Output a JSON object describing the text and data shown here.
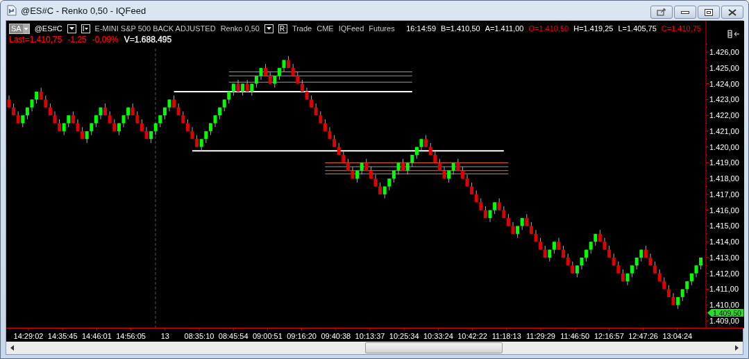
{
  "window": {
    "title": "@ES#C - Renko 0,50 - IQFeed"
  },
  "toolbar": {
    "session": "SA",
    "symbol": "@ES#C",
    "indicator_button": "I",
    "description": "E-MINI S&P 500 BACK ADJUSTED",
    "interval": "Renko 0,50",
    "range_button": "R",
    "fields": [
      "Trade",
      "CME",
      "IQFeed",
      "Futures"
    ],
    "quotes": [
      {
        "text": "16:14:59",
        "color": "#ffffff"
      },
      {
        "text": "B=1.410,50",
        "color": "#ffffff"
      },
      {
        "text": "A=1.411,00",
        "color": "#ffffff"
      },
      {
        "text": "O=1.410,50",
        "color": "#ff0000"
      },
      {
        "text": "H=1.419,25",
        "color": "#ffffff"
      },
      {
        "text": "L=1.405,75",
        "color": "#ffffff"
      },
      {
        "text": "C=1.410,75",
        "color": "#ff0000"
      }
    ],
    "last": [
      {
        "text": "Last=1.410,75",
        "color": "#ff0000"
      },
      {
        "text": "-1,25",
        "color": "#ff0000"
      },
      {
        "text": "-0,09%",
        "color": "#ff0000"
      },
      {
        "text": "V=1.688.495",
        "color": "#ffffff"
      }
    ]
  },
  "chart_data": {
    "type": "candlestick",
    "ylim": [
      1408.56,
      1427.98
    ],
    "ohlc": [
      [
        1423,
        1423.25,
        1422.5,
        1422.5
      ],
      [
        1422.5,
        1422.75,
        1422,
        1422
      ],
      [
        1422,
        1422.25,
        1421.5,
        1421.5
      ],
      [
        1421.5,
        1422,
        1421.25,
        1422
      ],
      [
        1422,
        1422.5,
        1421.75,
        1422.5
      ],
      [
        1422.5,
        1423,
        1422.25,
        1423
      ],
      [
        1423,
        1423.5,
        1422.75,
        1423.5
      ],
      [
        1423.5,
        1423.75,
        1423,
        1423
      ],
      [
        1423,
        1423.25,
        1422.5,
        1422.5
      ],
      [
        1422.5,
        1422.75,
        1422,
        1422
      ],
      [
        1422,
        1422.25,
        1421.5,
        1421.5
      ],
      [
        1421.5,
        1421.75,
        1421,
        1421
      ],
      [
        1421,
        1421.5,
        1420.75,
        1421.5
      ],
      [
        1421.5,
        1422,
        1421.25,
        1422
      ],
      [
        1422,
        1422.25,
        1421.5,
        1421.5
      ],
      [
        1421.5,
        1421.75,
        1421,
        1421
      ],
      [
        1421,
        1421.25,
        1420.5,
        1420.5
      ],
      [
        1420.5,
        1421,
        1420.25,
        1421
      ],
      [
        1421,
        1421.5,
        1420.75,
        1421.5
      ],
      [
        1421.5,
        1422,
        1421.25,
        1422
      ],
      [
        1422,
        1422.5,
        1421.75,
        1422.5
      ],
      [
        1422.5,
        1422.75,
        1422,
        1422
      ],
      [
        1422,
        1422.25,
        1421.5,
        1421.5
      ],
      [
        1421.5,
        1421.75,
        1421,
        1421
      ],
      [
        1421,
        1421.5,
        1420.75,
        1421.5
      ],
      [
        1421.5,
        1422,
        1421.25,
        1422
      ],
      [
        1422,
        1422.5,
        1421.75,
        1422.5
      ],
      [
        1422.5,
        1422.75,
        1422,
        1422
      ],
      [
        1422,
        1422.25,
        1421.5,
        1421.5
      ],
      [
        1421.5,
        1421.75,
        1421,
        1421
      ],
      [
        1421,
        1421.25,
        1420.5,
        1420.5
      ],
      [
        1420.5,
        1421,
        1420.25,
        1421
      ],
      [
        1421,
        1421.5,
        1420.75,
        1421.5
      ],
      [
        1421.5,
        1422,
        1421.25,
        1422
      ],
      [
        1422,
        1422.5,
        1421.75,
        1422.5
      ],
      [
        1422.5,
        1423,
        1422.25,
        1423
      ],
      [
        1423,
        1423.25,
        1422.5,
        1422.5
      ],
      [
        1422.5,
        1422.75,
        1422,
        1422
      ],
      [
        1422,
        1422.25,
        1421.5,
        1421.5
      ],
      [
        1421.5,
        1421.75,
        1421,
        1421
      ],
      [
        1421,
        1421.25,
        1420.5,
        1420.5
      ],
      [
        1420.5,
        1420.75,
        1420,
        1420
      ],
      [
        1420,
        1420.5,
        1419.75,
        1420.5
      ],
      [
        1420.5,
        1421,
        1420.25,
        1421
      ],
      [
        1421,
        1421.5,
        1420.75,
        1421.5
      ],
      [
        1421.5,
        1422,
        1421.25,
        1422
      ],
      [
        1422,
        1422.5,
        1421.75,
        1422.5
      ],
      [
        1422.5,
        1423,
        1422.25,
        1423
      ],
      [
        1423,
        1423.5,
        1422.75,
        1423.5
      ],
      [
        1423.5,
        1424,
        1423.25,
        1424
      ],
      [
        1424,
        1424.25,
        1423.5,
        1423.5
      ],
      [
        1423.5,
        1424,
        1423.25,
        1424
      ],
      [
        1424,
        1424.25,
        1423.5,
        1423.5
      ],
      [
        1423.5,
        1424,
        1423.25,
        1424
      ],
      [
        1424,
        1424.5,
        1423.75,
        1424.5
      ],
      [
        1424.5,
        1425,
        1424.25,
        1425
      ],
      [
        1425,
        1425.25,
        1424.5,
        1424.5
      ],
      [
        1424.5,
        1424.75,
        1424,
        1424
      ],
      [
        1424,
        1424.5,
        1423.75,
        1424.5
      ],
      [
        1424.5,
        1425,
        1424.25,
        1425
      ],
      [
        1425,
        1425.5,
        1424.75,
        1425.5
      ],
      [
        1425.5,
        1425.75,
        1425,
        1425
      ],
      [
        1425,
        1425.25,
        1424.5,
        1424.5
      ],
      [
        1424.5,
        1424.75,
        1424,
        1424
      ],
      [
        1424,
        1424.25,
        1423.5,
        1423.5
      ],
      [
        1423.5,
        1423.75,
        1423,
        1423
      ],
      [
        1423,
        1423.25,
        1422.5,
        1422.5
      ],
      [
        1422.5,
        1422.75,
        1422,
        1422
      ],
      [
        1422,
        1422.25,
        1421.5,
        1421.5
      ],
      [
        1421.5,
        1421.75,
        1421,
        1421
      ],
      [
        1421,
        1421.25,
        1420.5,
        1420.5
      ],
      [
        1420.5,
        1420.75,
        1420,
        1420
      ],
      [
        1420,
        1420.25,
        1419.5,
        1419.5
      ],
      [
        1419.5,
        1419.75,
        1419,
        1419
      ],
      [
        1419,
        1419.25,
        1418.5,
        1418.5
      ],
      [
        1418.5,
        1418.75,
        1418,
        1418
      ],
      [
        1418,
        1418.5,
        1417.75,
        1418.5
      ],
      [
        1418.5,
        1419,
        1418.25,
        1419
      ],
      [
        1419,
        1419.25,
        1418.5,
        1418.5
      ],
      [
        1418.5,
        1418.75,
        1418,
        1418
      ],
      [
        1418,
        1418.25,
        1417.5,
        1417.5
      ],
      [
        1417.5,
        1417.75,
        1417,
        1417
      ],
      [
        1417,
        1417.5,
        1416.75,
        1417.5
      ],
      [
        1417.5,
        1418,
        1417.25,
        1418
      ],
      [
        1418,
        1418.5,
        1417.75,
        1418.5
      ],
      [
        1418.5,
        1419,
        1418.25,
        1419
      ],
      [
        1419,
        1419.25,
        1418.5,
        1418.5
      ],
      [
        1418.5,
        1419,
        1418.25,
        1419
      ],
      [
        1419,
        1419.5,
        1418.75,
        1419.5
      ],
      [
        1419.5,
        1420,
        1419.25,
        1420
      ],
      [
        1420,
        1420.5,
        1419.75,
        1420.5
      ],
      [
        1420.5,
        1420.75,
        1420,
        1420
      ],
      [
        1420,
        1420.25,
        1419.5,
        1419.5
      ],
      [
        1419.5,
        1419.75,
        1419,
        1419
      ],
      [
        1419,
        1419.25,
        1418.5,
        1418.5
      ],
      [
        1418.5,
        1418.75,
        1418,
        1418
      ],
      [
        1418,
        1418.5,
        1417.75,
        1418.5
      ],
      [
        1418.5,
        1419,
        1418.25,
        1419
      ],
      [
        1419,
        1419.25,
        1418.5,
        1418.5
      ],
      [
        1418.5,
        1418.75,
        1418,
        1418
      ],
      [
        1418,
        1418.25,
        1417.5,
        1417.5
      ],
      [
        1417.5,
        1417.75,
        1417,
        1417
      ],
      [
        1417,
        1417.25,
        1416.5,
        1416.5
      ],
      [
        1416.5,
        1416.75,
        1416,
        1416
      ],
      [
        1416,
        1416.25,
        1415.5,
        1415.5
      ],
      [
        1415.5,
        1416,
        1415.25,
        1416
      ],
      [
        1416,
        1416.5,
        1415.75,
        1416.5
      ],
      [
        1416.5,
        1416.75,
        1416,
        1416
      ],
      [
        1416,
        1416.25,
        1415.5,
        1415.5
      ],
      [
        1415.5,
        1415.75,
        1415,
        1415
      ],
      [
        1415,
        1415.25,
        1414.5,
        1414.5
      ],
      [
        1414.5,
        1415,
        1414.25,
        1415
      ],
      [
        1415,
        1415.5,
        1414.75,
        1415.5
      ],
      [
        1415.5,
        1415.75,
        1415,
        1415
      ],
      [
        1415,
        1415.25,
        1414.5,
        1414.5
      ],
      [
        1414.5,
        1414.75,
        1414,
        1414
      ],
      [
        1414,
        1414.25,
        1413.5,
        1413.5
      ],
      [
        1413.5,
        1413.75,
        1413,
        1413
      ],
      [
        1413,
        1413.5,
        1412.75,
        1413.5
      ],
      [
        1413.5,
        1414,
        1413.25,
        1414
      ],
      [
        1414,
        1414.25,
        1413.5,
        1413.5
      ],
      [
        1413.5,
        1413.75,
        1413,
        1413
      ],
      [
        1413,
        1413.25,
        1412.5,
        1412.5
      ],
      [
        1412.5,
        1412.75,
        1412,
        1412
      ],
      [
        1412,
        1412.5,
        1411.75,
        1412.5
      ],
      [
        1412.5,
        1413,
        1412.25,
        1413
      ],
      [
        1413,
        1413.5,
        1412.75,
        1413.5
      ],
      [
        1413.5,
        1414,
        1413.25,
        1414
      ],
      [
        1414,
        1414.5,
        1413.75,
        1414.5
      ],
      [
        1414.5,
        1414.75,
        1414,
        1414
      ],
      [
        1414,
        1414.25,
        1413.5,
        1413.5
      ],
      [
        1413.5,
        1413.75,
        1413,
        1413
      ],
      [
        1413,
        1413.25,
        1412.5,
        1412.5
      ],
      [
        1412.5,
        1412.75,
        1412,
        1412
      ],
      [
        1412,
        1412.25,
        1411.5,
        1411.5
      ],
      [
        1411.5,
        1412,
        1411.25,
        1412
      ],
      [
        1412,
        1412.5,
        1411.75,
        1412.5
      ],
      [
        1412.5,
        1413,
        1412.25,
        1413
      ],
      [
        1413,
        1413.5,
        1412.75,
        1413.5
      ],
      [
        1413.5,
        1413.75,
        1413,
        1413
      ],
      [
        1413,
        1413.25,
        1412.5,
        1412.5
      ],
      [
        1412.5,
        1412.75,
        1412,
        1412
      ],
      [
        1412,
        1412.25,
        1411.5,
        1411.5
      ],
      [
        1411.5,
        1411.75,
        1411,
        1411
      ],
      [
        1411,
        1411.25,
        1410.5,
        1410.5
      ],
      [
        1410.5,
        1410.75,
        1410,
        1410
      ],
      [
        1410,
        1410.5,
        1409.75,
        1410.5
      ],
      [
        1410.5,
        1411,
        1410.25,
        1411
      ],
      [
        1411,
        1411.5,
        1410.75,
        1411.5
      ],
      [
        1411.5,
        1412,
        1411.25,
        1412
      ],
      [
        1412,
        1412.5,
        1411.75,
        1412.5
      ],
      [
        1412.5,
        1413,
        1412.25,
        1413
      ]
    ],
    "yticks": [
      {
        "value": 1426,
        "label": "1.426,00"
      },
      {
        "value": 1425,
        "label": "1.425,00"
      },
      {
        "value": 1424,
        "label": "1.424,00"
      },
      {
        "value": 1423,
        "label": "1.423,00"
      },
      {
        "value": 1422,
        "label": "1.422,00"
      },
      {
        "value": 1421,
        "label": "1.421,00"
      },
      {
        "value": 1420,
        "label": "1.420,00"
      },
      {
        "value": 1419,
        "label": "1.419,00"
      },
      {
        "value": 1418,
        "label": "1.418,00"
      },
      {
        "value": 1417,
        "label": "1.417,00"
      },
      {
        "value": 1416,
        "label": "1.416,00"
      },
      {
        "value": 1415,
        "label": "1.415,00"
      },
      {
        "value": 1414,
        "label": "1.414,00"
      },
      {
        "value": 1413,
        "label": "1.413,00"
      },
      {
        "value": 1412,
        "label": "1.412,00"
      },
      {
        "value": 1411,
        "label": "1.411,00"
      },
      {
        "value": 1410,
        "label": "1.410,00"
      },
      {
        "value": 1409,
        "label": "1.409,00"
      }
    ],
    "ref_lines": [
      {
        "axis": "y",
        "value": 1423.5,
        "color": "#ffffff"
      },
      {
        "axis": "y",
        "value": 1419.75,
        "color": "#ffffff"
      },
      {
        "axis": "y",
        "value": 1424.75,
        "color": "#9a9a9a"
      },
      {
        "axis": "y",
        "value": 1424.5,
        "color": "#9a9a9a"
      },
      {
        "axis": "y",
        "value": 1424.1,
        "color": "#9a9a9a"
      },
      {
        "axis": "y",
        "value": 1419.0,
        "color": "#ff6a1a"
      },
      {
        "axis": "y",
        "value": 1418.75,
        "color": "#9a9a9a"
      },
      {
        "axis": "y",
        "value": 1418.5,
        "color": "#ff6a1a"
      },
      {
        "axis": "y",
        "value": 1418.3,
        "color": "#9a9a9a"
      }
    ]
  },
  "time_axis": {
    "labels": [
      "14:29:02",
      "14:35:45",
      "14:46:01",
      "14:56:05",
      "13",
      "08:35:10",
      "08:45:54",
      "09:00:51",
      "09:16:20",
      "09:40:38",
      "10:13:37",
      "10:25:34",
      "10:33:24",
      "10:42:22",
      "11:18:13",
      "11:29:29",
      "11:46:50",
      "12:16:57",
      "12:47:26",
      "13:04:24"
    ]
  },
  "last_price_tag": {
    "label": "1.409,50"
  }
}
